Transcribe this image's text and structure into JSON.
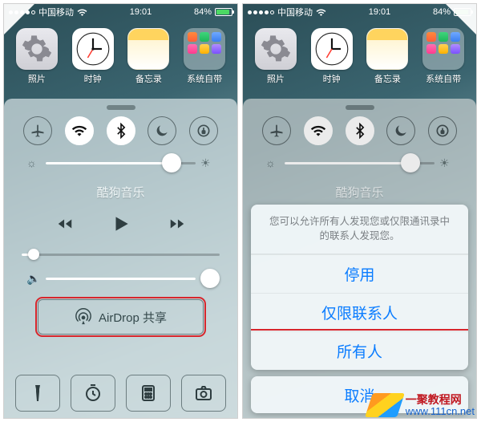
{
  "status": {
    "carrier": "中国移动",
    "time": "19:01",
    "battery_pct": "84%"
  },
  "apps": [
    {
      "label": "照片",
      "icon": "settings"
    },
    {
      "label": "时钟",
      "icon": "clock"
    },
    {
      "label": "备忘录",
      "icon": "memo"
    },
    {
      "label": "系统自带",
      "icon": "folder"
    }
  ],
  "cc": {
    "toggles": [
      {
        "name": "airplane",
        "on": false
      },
      {
        "name": "wifi",
        "on": true
      },
      {
        "name": "bluetooth",
        "on": true
      },
      {
        "name": "dnd",
        "on": false
      },
      {
        "name": "rotation-lock",
        "on": false
      }
    ],
    "brightness_pct": 82,
    "now_playing": "酷狗音乐",
    "scrub_pct": 6,
    "volume_pct": 100,
    "airdrop_label": "AirDrop 共享",
    "quick": [
      "flashlight",
      "timer",
      "calculator",
      "camera"
    ]
  },
  "sheet": {
    "message": "您可以允许所有人发现您或仅限通讯录中的联系人发现您。",
    "options": [
      "停用",
      "仅限联系人",
      "所有人"
    ],
    "highlight_index": 2,
    "cancel": "取消"
  },
  "watermark": {
    "site_cn": "一聚教程网",
    "site_url": "www.111cn.net"
  }
}
